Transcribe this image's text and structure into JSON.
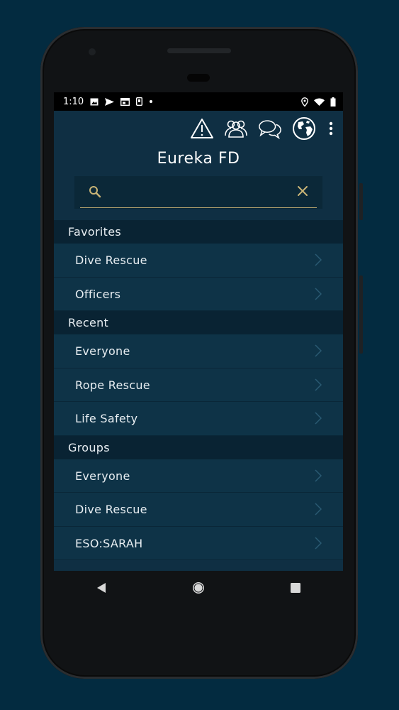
{
  "status_bar": {
    "time": "1:10",
    "left_icons": [
      "image-icon",
      "send-icon",
      "calendar-icon",
      "phone-icon",
      "dot-icon"
    ],
    "right_icons": [
      "location-icon",
      "wifi-icon",
      "battery-icon"
    ]
  },
  "app_bar": {
    "icons": [
      "alert-triangle-icon",
      "people-icon",
      "chat-bubbles-icon",
      "globe-icon",
      "more-vertical-icon"
    ]
  },
  "title": "Eureka FD",
  "search": {
    "value": "",
    "placeholder": ""
  },
  "sections": [
    {
      "header": "Favorites",
      "items": [
        "Dive Rescue",
        "Officers"
      ]
    },
    {
      "header": "Recent",
      "items": [
        "Everyone",
        "Rope Rescue",
        "Life Safety"
      ]
    },
    {
      "header": "Groups",
      "items": [
        "Everyone",
        "Dive Rescue",
        "ESO:SARAH"
      ]
    }
  ],
  "nav_bar": {
    "icons": [
      "back-icon",
      "home-icon",
      "recents-icon"
    ]
  },
  "colors": {
    "background": "#032b40",
    "screen": "#0f2f43",
    "row": "#0e3347",
    "section_header": "#092333",
    "accent": "#b7a46e"
  }
}
